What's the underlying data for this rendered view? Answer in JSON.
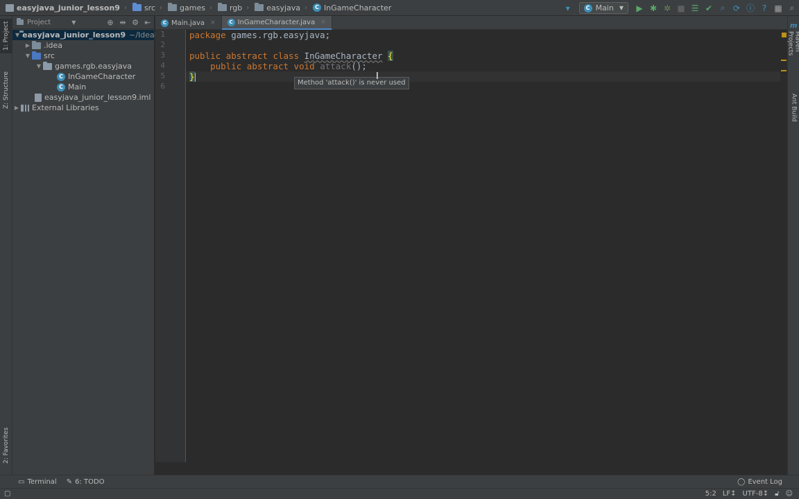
{
  "breadcrumbs": [
    {
      "label": "easyjava_junior_lesson9",
      "icon": "project-icon"
    },
    {
      "label": "src",
      "icon": "folder-icon"
    },
    {
      "label": "games",
      "icon": "folder-icon"
    },
    {
      "label": "rgb",
      "icon": "folder-icon"
    },
    {
      "label": "easyjava",
      "icon": "folder-icon"
    },
    {
      "label": "InGameCharacter",
      "icon": "class-icon"
    }
  ],
  "run_config": {
    "label": "Main",
    "icon_letter": "C"
  },
  "left_stripe": {
    "project": "1: Project",
    "structure": "Z: Structure",
    "favorites": "2: Favorites"
  },
  "right_stripe": {
    "maven": "Maven Projects",
    "ant": "Ant Build"
  },
  "project_panel": {
    "header": "Project",
    "tree": [
      {
        "label": "easyjava_junior_lesson9",
        "suffix": "~/IdeaPr",
        "depth": 0,
        "expanded": true,
        "icon": "project-icon",
        "bold": true
      },
      {
        "label": ".idea",
        "depth": 1,
        "expanded": false,
        "icon": "folder-icon"
      },
      {
        "label": "src",
        "depth": 1,
        "expanded": true,
        "icon": "folder-src-icon"
      },
      {
        "label": "games.rgb.easyjava",
        "depth": 2,
        "expanded": true,
        "icon": "package-icon"
      },
      {
        "label": "InGameCharacter",
        "depth": 3,
        "icon": "class-icon"
      },
      {
        "label": "Main",
        "depth": 3,
        "icon": "class-icon"
      },
      {
        "label": "easyjava_junior_lesson9.iml",
        "depth": 1,
        "icon": "iml-icon"
      },
      {
        "label": "External Libraries",
        "depth": 0,
        "expanded": false,
        "icon": "library-icon"
      }
    ]
  },
  "tabs": [
    {
      "label": "Main.java",
      "active": false
    },
    {
      "label": "InGameCharacter.java",
      "active": true
    }
  ],
  "editor": {
    "line_numbers": [
      "1",
      "2",
      "3",
      "4",
      "5",
      "6"
    ],
    "line1": {
      "kw": "package",
      "rest": " games.rgb.easyjava;"
    },
    "line3": {
      "kw1": "public",
      "kw2": "abstract",
      "kw3": "class",
      "cls": "InGameCharacter",
      "brace": "{"
    },
    "line4": {
      "indent": "    ",
      "kw1": "public",
      "kw2": "abstract",
      "kw3": "void",
      "method": "attack",
      "rest": "();"
    },
    "line5": {
      "brace": "}"
    },
    "tooltip": "Method 'attack()' is never used"
  },
  "bottom_tabs": {
    "terminal": "Terminal",
    "todo": "6: TODO",
    "event_log": "Event Log"
  },
  "status": {
    "position": "5:2",
    "line_sep": "LF↕",
    "encoding": "UTF-8↕"
  },
  "colors": {
    "keyword": "#cc7832",
    "text": "#a9b7c6",
    "background": "#2b2b2b",
    "panel": "#3c3f41",
    "accent": "#4a88c7"
  }
}
